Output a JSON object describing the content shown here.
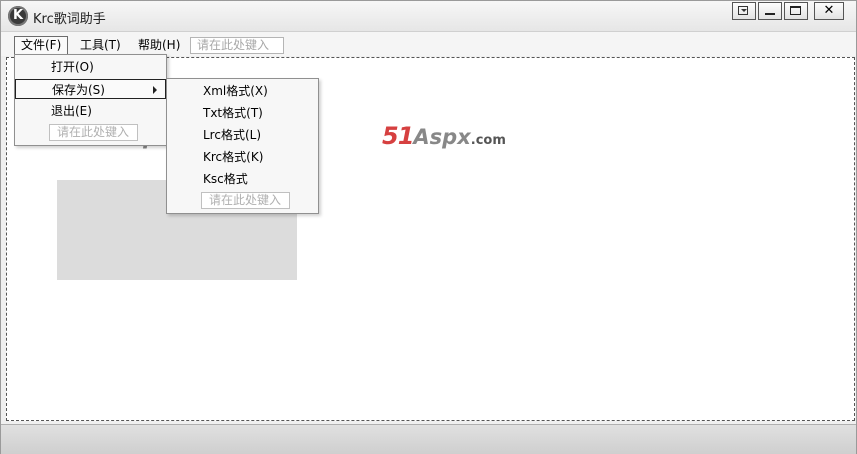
{
  "window": {
    "title": "Krc歌词助手",
    "logo_letter": "K",
    "controls": {
      "menu": "menu",
      "minimize": "minimize",
      "maximize": "maximize",
      "close": "✕"
    }
  },
  "menubar": {
    "items": [
      {
        "label": "文件(F)"
      },
      {
        "label": "工具(T)"
      },
      {
        "label": "帮助(H)"
      }
    ],
    "input_placeholder": "请在此处键入"
  },
  "file_menu": {
    "items": [
      {
        "label": "打开(O)"
      },
      {
        "label": "保存为(S)"
      },
      {
        "label": "退出(E)"
      }
    ],
    "input_placeholder": "请在此处键入"
  },
  "save_as_menu": {
    "items": [
      {
        "label": "Xml格式(X)"
      },
      {
        "label": "Txt格式(T)"
      },
      {
        "label": "Lrc格式(L)"
      },
      {
        "label": "Krc格式(K)"
      },
      {
        "label": "Ksc格式"
      }
    ],
    "input_placeholder": "请在此处键入"
  },
  "watermark": {
    "number": "51",
    "brand": "Aspx",
    "suffix": ".com"
  },
  "colors": {
    "watermark_red": "#d64040",
    "watermark_gray": "#888888"
  }
}
